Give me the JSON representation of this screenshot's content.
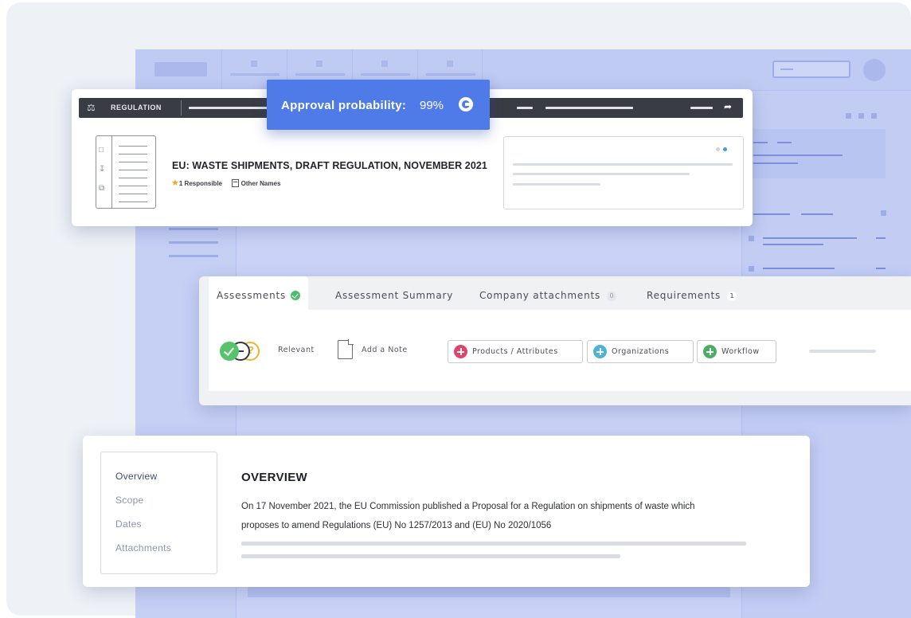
{
  "regulation_card": {
    "category_label": "REGULATION",
    "title": "EU: WASTE SHIPMENTS, DRAFT REGULATION, NOVEMBER 2021",
    "responsible": "1 Responsible",
    "other_names": "Other Names"
  },
  "approval": {
    "label": "Approval probability:",
    "value": "99%"
  },
  "assessment_panel": {
    "tabs": [
      {
        "label": "Assessments",
        "indicator": "check-icon"
      },
      {
        "label": "Assessment Summary"
      },
      {
        "label": "Company attachments",
        "badge": "0"
      },
      {
        "label": "Requirements",
        "badge": "1"
      }
    ],
    "status_label": "Relevant",
    "add_note_label": "Add a Note",
    "pills": [
      {
        "label": "Products / Attributes",
        "color": "#e0436b"
      },
      {
        "label": "Organizations",
        "color": "#4cb4d6"
      },
      {
        "label": "Workflow",
        "color": "#4cae63"
      }
    ]
  },
  "overview_card": {
    "nav": [
      {
        "label": "Overview",
        "active": true
      },
      {
        "label": "Scope"
      },
      {
        "label": "Dates"
      },
      {
        "label": "Attachments"
      }
    ],
    "heading": "OVERVIEW",
    "text_line1": "On 17 November 2021, the EU Commission published a Proposal for a Regulation on shipments of waste which",
    "text_line2": "proposes to amend Regulations (EU) No 1257/2013 and (EU) No 2020/1056"
  },
  "colors": {
    "accent_blue": "#4f7be8",
    "background_app": "#c6d0f5",
    "dark_bar": "#393c43"
  }
}
